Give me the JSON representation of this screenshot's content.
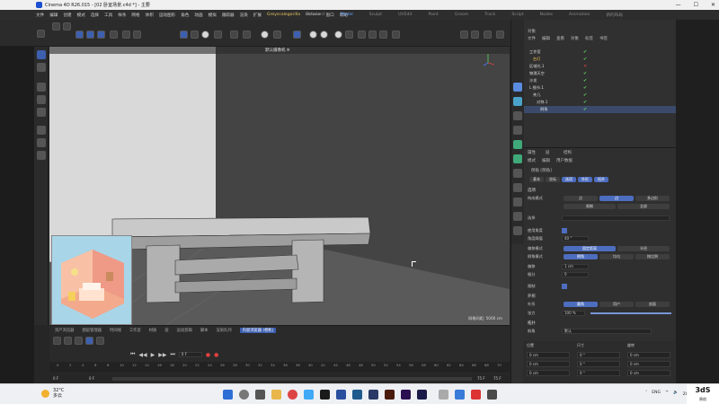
{
  "window": {
    "title": "Cinema 4D R26.015 - [02 卧室场景.c4d *] - 主要"
  },
  "menubar": {
    "items": [
      "文件",
      "编辑",
      "创建",
      "模式",
      "选择",
      "工具",
      "样条",
      "网格",
      "体积",
      "运动图形",
      "角色",
      "动画",
      "模拟",
      "跟踪器",
      "渲染",
      "扩展",
      "Greyscalegorilla",
      "Octane",
      "窗口",
      "帮助"
    ],
    "active_index": 16,
    "layouts": [
      "Standard",
      "Model",
      "Sculpt",
      "UVEdit",
      "Paint",
      "Groom",
      "Track",
      "Script",
      "Nodes",
      "Animation"
    ],
    "active_layout": 1,
    "new_layout": "新的布局"
  },
  "viewport": {
    "camera_label": "默认摄像机 ✲",
    "grid_distance": "网格间距: 5000 cm"
  },
  "objects_panel": {
    "tabs": [
      "文件",
      "编辑",
      "查看",
      "对象",
      "标签",
      "书签"
    ],
    "header": "对象",
    "rows": [
      {
        "name": "工作室",
        "state": "check"
      },
      {
        "name": "台灯",
        "state": "check"
      },
      {
        "name": "区域光.1",
        "state": "cross"
      },
      {
        "name": "物理天空",
        "state": "check"
      },
      {
        "name": "沙发",
        "state": "check"
      },
      {
        "name": "L 细节.1",
        "state": "check"
      },
      {
        "name": "茶几",
        "state": "check"
      },
      {
        "name": "对称.1",
        "state": "check"
      },
      {
        "name": "倒角",
        "state": "check"
      }
    ]
  },
  "attributes": {
    "tabs": [
      "属性",
      "层",
      "结构"
    ],
    "menu": [
      "模式",
      "编辑",
      "用户数据"
    ],
    "object_title": "倒角 [倒角]",
    "subtabs": [
      "基本",
      "坐标",
      "选项",
      "外形",
      "拓扑",
      "着色"
    ],
    "section": "选项",
    "mode_label": "构成模式",
    "mode_options": [
      "点",
      "边",
      "多边形"
    ],
    "sub_options": [
      "限制",
      "全部"
    ],
    "selection_label": "选择",
    "use_angle_label": "使用角度",
    "angle_threshold_label": "角度阈值",
    "angle_threshold_value": "40 °",
    "offset_mode_label": "偏移模式",
    "offset_mode_options": [
      "固定距离",
      "半径"
    ],
    "bevel_mode_label": "倒角模式",
    "bevel_mode_options": [
      "倒角",
      "均匀",
      "按比例"
    ],
    "offset_label": "偏移",
    "offset_value": "1 cm",
    "subdivision_label": "细分",
    "subdivision_value": "0",
    "limit_label": "限制",
    "shaping_section": "外形",
    "shape_label": "外形",
    "shape_options": [
      "圆角",
      "用户",
      "剖面"
    ],
    "tension_label": "张力",
    "tension_value": "100 %",
    "topology_section": "拓扑",
    "corner_label": "斜角",
    "corner_value": "默认",
    "tension_level": 1
  },
  "coords": {
    "header": [
      "位置",
      "尺寸",
      "旋转"
    ],
    "rows": [
      [
        "0 cm",
        "0 °",
        "0 cm"
      ],
      [
        "0 cm",
        "0 °",
        "0 cm"
      ],
      [
        "0 cm",
        "0 °",
        "0 cm"
      ]
    ]
  },
  "timeline": {
    "tabs": [
      "资产浏览器",
      "图层管理器",
      "时间线",
      "工作室",
      "材质",
      "层",
      "运动剪辑",
      "脚本",
      "渲染队列",
      "工作序列",
      "TL.got概",
      "内容浏览器 (相机)",
      "内容浏览"
    ],
    "active_tab": 11,
    "ticks": [
      "0",
      "2",
      "4",
      "6",
      "8",
      "10",
      "12",
      "14",
      "16",
      "18",
      "20",
      "22",
      "24",
      "26",
      "28",
      "30",
      "32",
      "34",
      "36",
      "38",
      "40",
      "42",
      "44",
      "46",
      "48",
      "50",
      "52",
      "54",
      "56",
      "58",
      "60",
      "62",
      "64",
      "66",
      "68",
      "70"
    ],
    "start": "0 F",
    "start2": "0 F",
    "end": "75 F",
    "end2": "75 F",
    "current": "0 F"
  },
  "taskbar": {
    "temp": "32°C",
    "weather": "多云",
    "lang": "ENG",
    "time": "19:51",
    "date": "2022/7/1",
    "brand": "3dS",
    "brand_sub": "原创"
  }
}
